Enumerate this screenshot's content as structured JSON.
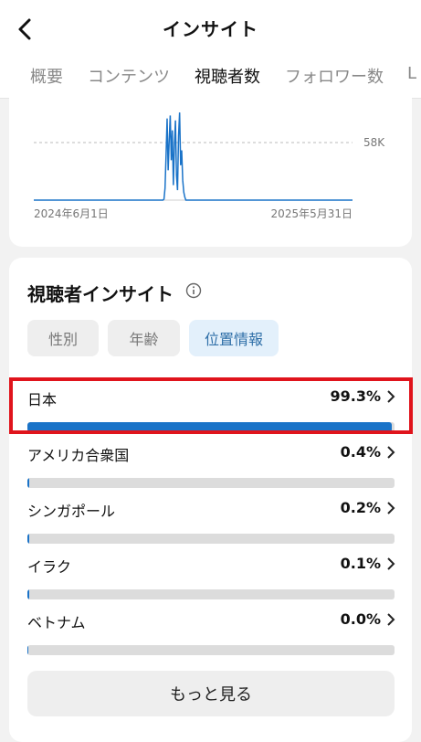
{
  "header": {
    "title": "インサイト",
    "back_icon": "chevron-left-icon"
  },
  "tabs": [
    {
      "label": "概要",
      "active": false
    },
    {
      "label": "コンテンツ",
      "active": false
    },
    {
      "label": "視聴者数",
      "active": true
    },
    {
      "label": "フォロワー数",
      "active": false
    },
    {
      "label": "L",
      "active": false
    }
  ],
  "chart": {
    "y_tick_label": "58K",
    "x_start_label": "2024年6月1日",
    "x_end_label": "2025年5月31日"
  },
  "chart_data": {
    "type": "line",
    "title": "",
    "xlabel": "",
    "ylabel": "",
    "x_range": [
      "2024年6月1日",
      "2025年5月31日"
    ],
    "reference_line": {
      "value": 58000,
      "label": "58K",
      "style": "dashed"
    },
    "series": [
      {
        "values": [
          0,
          0,
          0,
          0,
          0,
          0,
          0,
          0,
          0,
          0,
          0,
          0,
          0,
          0,
          0,
          0,
          0,
          0,
          0,
          0,
          0,
          0,
          0,
          0,
          0,
          0,
          0,
          0,
          0,
          0,
          0,
          0,
          0,
          0,
          0,
          0,
          0,
          0,
          0,
          0,
          0,
          0,
          0,
          0,
          0,
          0,
          0,
          0,
          0,
          0,
          0,
          0,
          0,
          0,
          0,
          0,
          0,
          0,
          0,
          0,
          0,
          0,
          0,
          0,
          0,
          0,
          0,
          0,
          0,
          0,
          0,
          0,
          0,
          0,
          0,
          0,
          0,
          0,
          0,
          0,
          0,
          0,
          0,
          0,
          0,
          0,
          0,
          0,
          0,
          0,
          0,
          0,
          0,
          0,
          0,
          0,
          0,
          0,
          0,
          0,
          0,
          0,
          0,
          0,
          0,
          0,
          0,
          0,
          0,
          0,
          0,
          0,
          0,
          0,
          0,
          0,
          0,
          0,
          0,
          0,
          0,
          0,
          0,
          0,
          0,
          1000,
          12000,
          45000,
          82000,
          30000,
          60000,
          85000,
          40000,
          70000,
          15000,
          55000,
          80000,
          25000,
          10000,
          65000,
          88000,
          35000,
          50000,
          20000,
          8000,
          3000,
          0,
          0,
          0,
          0,
          0,
          0,
          0,
          0,
          0,
          0,
          0,
          0,
          0,
          0,
          0,
          0,
          0,
          0,
          0,
          0,
          0,
          0,
          0,
          0,
          0,
          0,
          0,
          0,
          0,
          0,
          0,
          0,
          0,
          0,
          0,
          0,
          0,
          0,
          0,
          0,
          0,
          0,
          0,
          0,
          0,
          0,
          0,
          0,
          0,
          0,
          0,
          0,
          0,
          0,
          0,
          0,
          0,
          0,
          0,
          0,
          0,
          0,
          0,
          0,
          0,
          0,
          0,
          0,
          0,
          0,
          0,
          0,
          0,
          0,
          0,
          0,
          0,
          0,
          0,
          0,
          0,
          0,
          0,
          0,
          0,
          0,
          0,
          0,
          0,
          0,
          0,
          0,
          0,
          0,
          0,
          0,
          0,
          0,
          0,
          0,
          0,
          0,
          0,
          0,
          0,
          0,
          0,
          0,
          0,
          0,
          0,
          0,
          0,
          0,
          0,
          0,
          0,
          0,
          0,
          0,
          0,
          0,
          0,
          0,
          0,
          0,
          0,
          0,
          0,
          0,
          0,
          0,
          0,
          0,
          0,
          0,
          0,
          0,
          0,
          0,
          0,
          0,
          0,
          0,
          0,
          0,
          0,
          0,
          0,
          0,
          0,
          0,
          0,
          0,
          0,
          0,
          0,
          0,
          0,
          0,
          0
        ]
      }
    ],
    "ylim": [
      0,
      100000
    ],
    "color": "#1a73c8"
  },
  "insight": {
    "title": "視聴者インサイト",
    "info_icon": "info-circle-icon",
    "chips": [
      {
        "label": "性別",
        "active": false
      },
      {
        "label": "年齢",
        "active": false
      },
      {
        "label": "位置情報",
        "active": true
      }
    ],
    "rows": [
      {
        "label": "日本",
        "value": "99.3%",
        "fraction": 0.993
      },
      {
        "label": "アメリカ合衆国",
        "value": "0.4%",
        "fraction": 0.004
      },
      {
        "label": "シンガポール",
        "value": "0.2%",
        "fraction": 0.002
      },
      {
        "label": "イラク",
        "value": "0.1%",
        "fraction": 0.001
      },
      {
        "label": "ベトナム",
        "value": "0.0%",
        "fraction": 0.0
      }
    ],
    "more_label": "もっと見る"
  },
  "colors": {
    "accent": "#1a73c8",
    "highlight": "#e0141c",
    "chip_active_bg": "#e3f0fb"
  }
}
